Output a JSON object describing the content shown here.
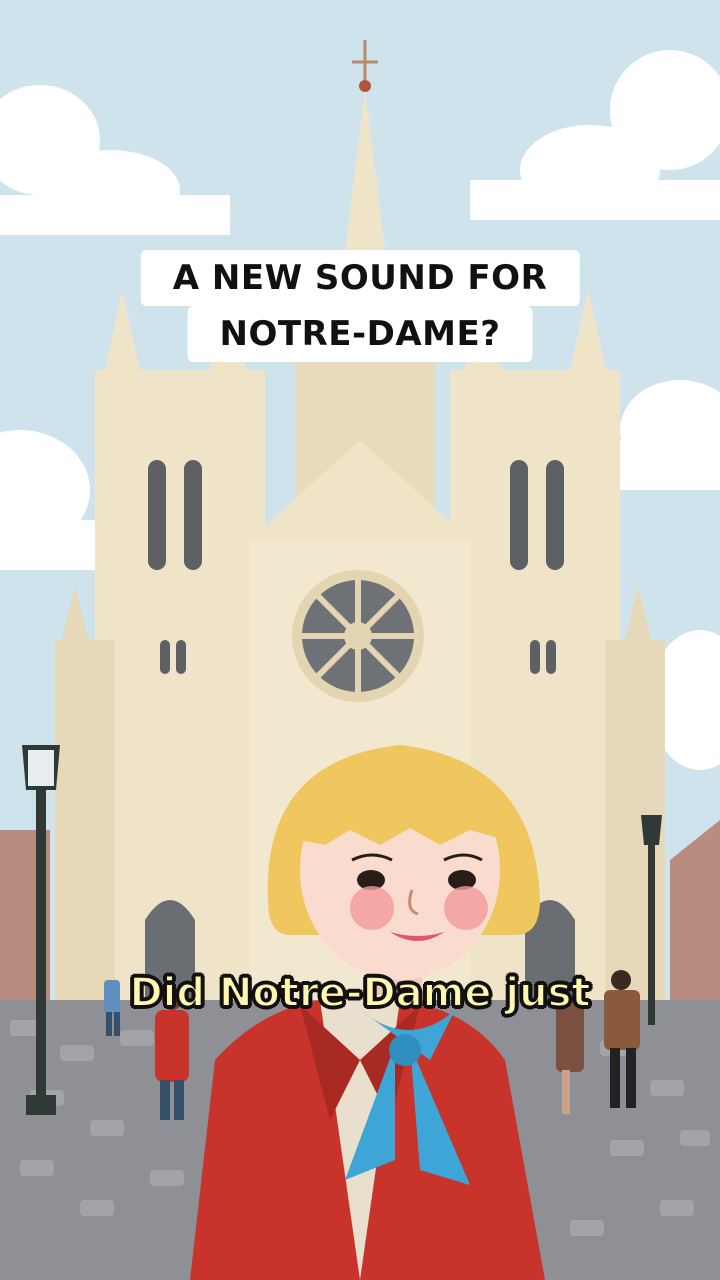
{
  "overlay": {
    "title_line_1": "A NEW SOUND FOR",
    "title_line_2": "NOTRE-DAME?",
    "caption": "Did Notre-Dame just"
  },
  "colors": {
    "sky": "#cfe3ec",
    "cathedral": "#efe4c8",
    "cathedral_shadow": "#d9cba7",
    "coat": "#c8342b",
    "scarf": "#3ea6d6",
    "hair": "#efc75e",
    "cobblestone": "#8f8f96",
    "caption_fill": "#fff7b0"
  },
  "icons": [
    "street-lamp-icon",
    "cross-icon"
  ]
}
